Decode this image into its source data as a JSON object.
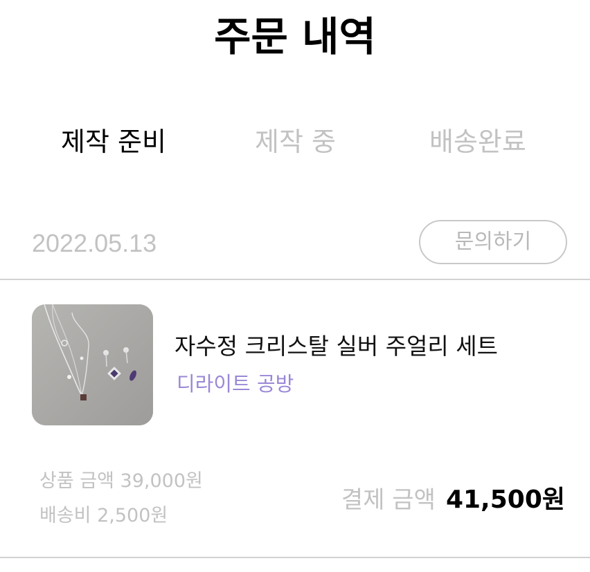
{
  "header": {
    "title": "주문 내역"
  },
  "tabs": [
    {
      "label": "제작 준비",
      "active": true
    },
    {
      "label": "제작 중",
      "active": false
    },
    {
      "label": "배송완료",
      "active": false
    }
  ],
  "order": {
    "date": "2022.05.13",
    "inquiry_label": "문의하기",
    "item": {
      "name": "자수정 크리스탈 실버 주얼리 세트",
      "shop": "디라이트 공방",
      "image_icon": "jewelry-set-photo"
    },
    "product_price_line": "상품 금액 39,000원",
    "shipping_line": "배송비 2,500원",
    "total_label": "결제 금액",
    "total_amount": "41,500원"
  },
  "colors": {
    "inactive_text": "#c2c2c2",
    "shop_accent": "#9a87d6",
    "divider": "#d2d2d2"
  }
}
